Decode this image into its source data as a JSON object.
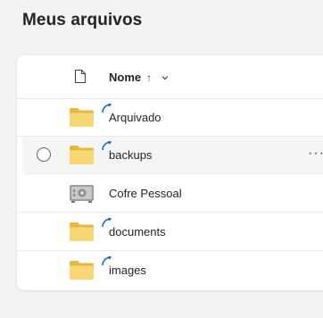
{
  "page": {
    "title": "Meus arquivos"
  },
  "header": {
    "name_label": "Nome",
    "sort_indicator": "↑"
  },
  "rows": [
    {
      "name": "Arquivado",
      "icon": "folder-icon",
      "synced": true
    },
    {
      "name": "backups",
      "icon": "folder-icon",
      "synced": true
    },
    {
      "name": "Cofre Pessoal",
      "icon": "vault-icon",
      "synced": false
    },
    {
      "name": "documents",
      "icon": "folder-icon",
      "synced": true
    },
    {
      "name": "images",
      "icon": "folder-icon",
      "synced": true
    }
  ],
  "colors": {
    "folder": "#f8d775",
    "folder_dark": "#e8b73d",
    "sync": "#0f6cbd"
  }
}
